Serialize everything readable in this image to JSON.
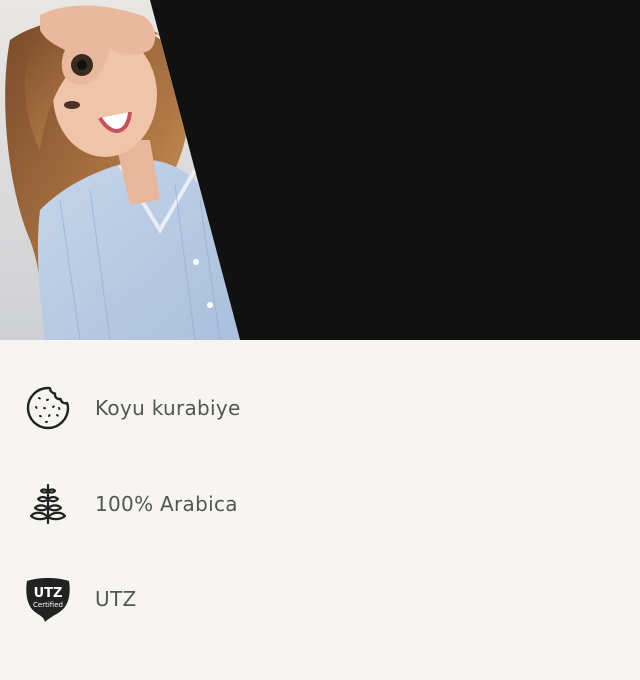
{
  "colors": {
    "hero_background": "#111111",
    "page_background": "#f6f5f1",
    "text": "#555555",
    "icon": "#222222"
  },
  "hero": {
    "image": "smiling-woman-okay-gesture-photo"
  },
  "features": [
    {
      "icon": "cookie-icon",
      "label": "Koyu kurabiye"
    },
    {
      "icon": "coffee-plant-icon",
      "label": "100% Arabica"
    },
    {
      "icon": "utz-certified-badge-icon",
      "label": "UTZ",
      "badge_text_top": "UTZ",
      "badge_text_bottom": "Certified"
    }
  ]
}
